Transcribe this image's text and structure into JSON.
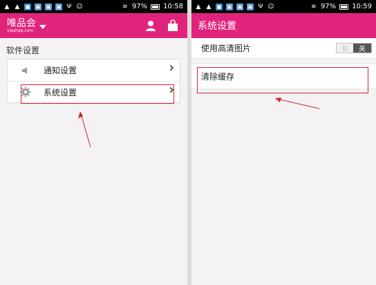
{
  "left_screen": {
    "status_bar": {
      "battery_percent": "97%",
      "time": "10:58"
    },
    "app_bar": {
      "brand_name": "唯品会",
      "brand_domain": "vipshop.com"
    },
    "section_title": "软件设置",
    "items": [
      {
        "label": "通知设置",
        "icon": "speaker-icon"
      },
      {
        "label": "系统设置",
        "icon": "gear-icon"
      }
    ]
  },
  "right_screen": {
    "status_bar": {
      "battery_percent": "97%",
      "time": "10:59"
    },
    "app_bar": {
      "title": "系统设置"
    },
    "hd_images": {
      "label": "使用高清图片",
      "toggle_state": "关",
      "track_mark": "|||"
    },
    "clear_cache": {
      "label": "清除缓存"
    }
  },
  "colors": {
    "brand": "#e1237b",
    "annotation": "#d0262e"
  }
}
